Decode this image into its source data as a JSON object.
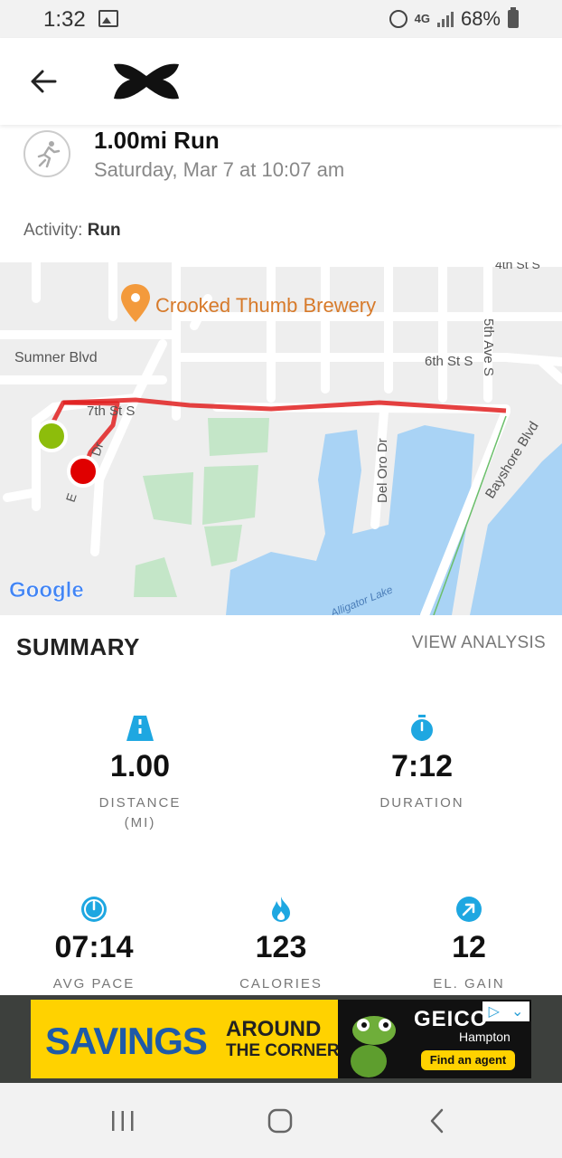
{
  "status_bar": {
    "time": "1:32",
    "network": "4G",
    "battery": "68%"
  },
  "header": {
    "back_icon": "arrow-left-icon",
    "logo": "under-armour-logo"
  },
  "workout": {
    "title": "1.00mi Run",
    "date": "Saturday, Mar 7 at 10:07 am",
    "activity_label": "Activity:",
    "activity_value": "Run"
  },
  "map": {
    "poi": "Crooked Thumb Brewery",
    "streets": [
      "Sumner Blvd",
      "7th St S",
      "6th St S",
      "5th Ave S",
      "4th St S",
      "Del Oro Dr",
      "Bayshore Blvd",
      "E",
      "Dr"
    ],
    "water_label": "Alligator Lake",
    "attribution": "Google",
    "route_color": "#e02020",
    "start_color": "#8dbd0b",
    "end_color": "#e00000"
  },
  "summary": {
    "title": "SUMMARY",
    "view_analysis": "VIEW ANALYSIS",
    "stats": [
      {
        "value": "1.00",
        "label": "DISTANCE",
        "unit": "(MI)",
        "icon": "road-icon"
      },
      {
        "value": "7:12",
        "label": "DURATION",
        "icon": "stopwatch-icon"
      },
      {
        "value": "07:14",
        "label": "AVG PACE",
        "icon": "speedometer-icon"
      },
      {
        "value": "123",
        "label": "CALORIES",
        "icon": "flame-icon"
      },
      {
        "value": "12",
        "label": "EL. GAIN",
        "icon": "arrow-up-right-icon"
      }
    ],
    "accent": "#1ea7e1"
  },
  "ad": {
    "savings": "SAVINGS",
    "around": "AROUND",
    "the_corner": "THE CORNER",
    "brand": "GEICO",
    "location": "Hampton",
    "cta": "Find an agent"
  }
}
